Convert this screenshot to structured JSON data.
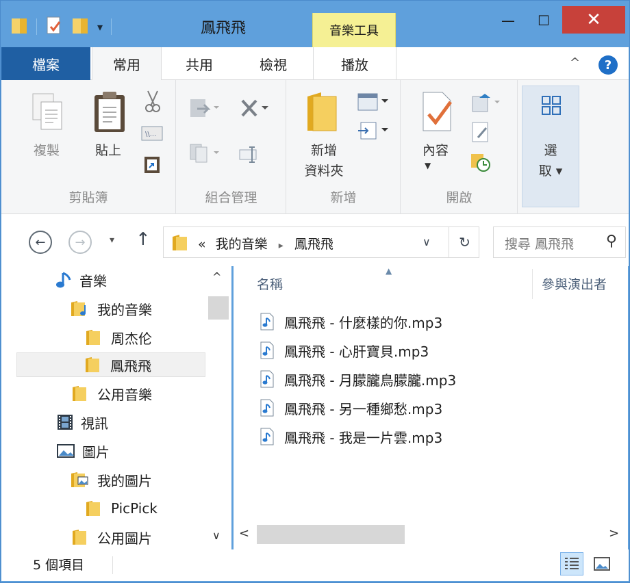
{
  "window": {
    "title": "鳳飛飛",
    "contextual_tab_group": "音樂工具",
    "minimize_glyph": "—",
    "maximize_glyph": "☐",
    "close_glyph": "✕"
  },
  "quick_access": {
    "dropdown_glyph": "▾"
  },
  "ribbon_tabs": {
    "file": "檔案",
    "home": "常用",
    "share": "共用",
    "view": "檢視",
    "play": "播放",
    "collapse_glyph": "^",
    "help_glyph": "?"
  },
  "ribbon": {
    "clipboard": {
      "label": "剪貼簿",
      "copy": "複製",
      "paste": "貼上"
    },
    "organize": {
      "label": "組合管理"
    },
    "new": {
      "label": "新增",
      "new_folder": "新增\n資料夾"
    },
    "open": {
      "label": "開啟",
      "properties": "內容"
    },
    "select": {
      "select_label": "選\n取 ▾"
    }
  },
  "address": {
    "back_glyph": "←",
    "forward_glyph": "→",
    "recent_glyph": "▾",
    "up_glyph": "↑",
    "overflow": "«",
    "segments": [
      "我的音樂",
      "鳳飛飛"
    ],
    "segment_separator": "▸",
    "dropdown_glyph": "∨",
    "refresh_glyph": "↻",
    "search_placeholder": "搜尋 鳳飛飛",
    "search_glyph": "⚲"
  },
  "nav_pane": {
    "items": [
      {
        "label": "音樂",
        "icon": "music-note-icon"
      },
      {
        "label": "我的音樂",
        "icon": "music-library-folder-icon"
      },
      {
        "label": "周杰伦",
        "icon": "folder-icon"
      },
      {
        "label": "鳳飛飛",
        "icon": "folder-icon",
        "selected": true
      },
      {
        "label": "公用音樂",
        "icon": "folder-icon"
      },
      {
        "label": "視訊",
        "icon": "film-icon"
      },
      {
        "label": "圖片",
        "icon": "picture-icon"
      },
      {
        "label": "我的圖片",
        "icon": "picture-library-folder-icon"
      },
      {
        "label": "PicPick",
        "icon": "folder-icon"
      },
      {
        "label": "公用圖片",
        "icon": "folder-icon"
      }
    ],
    "scroll_up_glyph": "^",
    "scroll_down_glyph": "∨"
  },
  "file_list": {
    "columns": {
      "name": "名稱",
      "artist": "參與演出者"
    },
    "sort_glyph": "▲",
    "files": [
      "鳳飛飛 - 什麼樣的你.mp3",
      "鳳飛飛 - 心肝寶貝.mp3",
      "鳳飛飛 - 月朦朧鳥朦朧.mp3",
      "鳳飛飛 - 另一種鄉愁.mp3",
      "鳳飛飛 - 我是一片雲.mp3"
    ],
    "scroll_left_glyph": "<",
    "scroll_right_glyph": ">"
  },
  "status": {
    "item_count": "5 個項目"
  },
  "colors": {
    "title_bar": "#5fa0dc",
    "file_tab": "#1f5fa3",
    "contextual_tab": "#f5f094",
    "close_button": "#c7413a",
    "folder": "#f0c24c"
  }
}
